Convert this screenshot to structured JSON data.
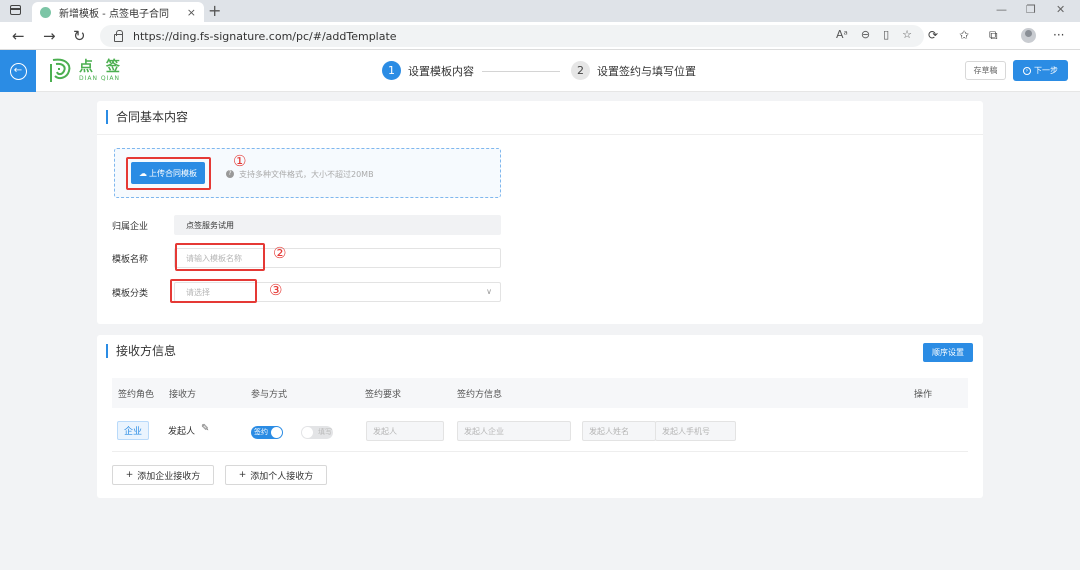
{
  "browser": {
    "tab_title": "新增模板 - 点签电子合同",
    "tab_close": "×",
    "new_tab": "+",
    "url": "https://ding.fs-signature.com/pc/#/addTemplate",
    "window_controls": [
      "—",
      "❐",
      "✕"
    ]
  },
  "header": {
    "logo_cn": "点 签",
    "logo_en": "DIAN QIAN",
    "steps": [
      {
        "number": "1",
        "label": "设置模板内容"
      },
      {
        "number": "2",
        "label": "设置签约与填写位置"
      }
    ],
    "draft_label": "存草稿",
    "next_label": "下一步"
  },
  "basic": {
    "title": "合同基本内容",
    "upload_label": "上传合同模板",
    "upload_hint": "支持多种文件格式，大小不超过20MB",
    "company_label": "归属企业",
    "company_value": "点签服务试用",
    "name_label": "模板名称",
    "name_placeholder": "请输入模板名称",
    "category_label": "模板分类",
    "category_placeholder": "请选择",
    "annotations": [
      "①",
      "②",
      "③"
    ]
  },
  "receivers": {
    "title": "接收方信息",
    "order_button": "顺序设置",
    "columns": [
      "签约角色",
      "接收方",
      "参与方式",
      "签约要求",
      "签约方信息",
      "操作"
    ],
    "row": {
      "role": "企业",
      "receiver": "发起人",
      "toggle_on": "签约",
      "toggle_off": "填写",
      "requirement": "发起人",
      "company": "发起人企业",
      "person_name": "发起人姓名",
      "phone": "发起人手机号"
    },
    "add_company": "添加企业接收方",
    "add_person": "添加个人接收方"
  },
  "colors": {
    "primary": "#2b8ce4",
    "highlight": "#e53935",
    "brand_green": "#4caf50"
  }
}
